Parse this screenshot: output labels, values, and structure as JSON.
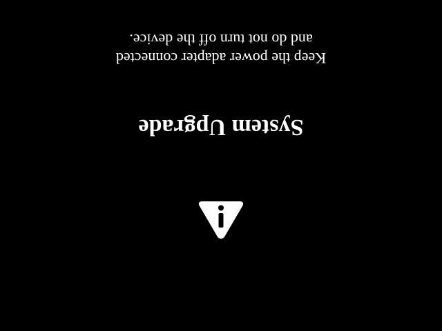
{
  "screen": {
    "orientation": "rotated-180",
    "background_color": "#000000",
    "text_color": "#ffffff"
  },
  "icon": {
    "name": "warning-triangle-exclamation-icon"
  },
  "title": "System Upgrade",
  "message": {
    "line1": "Keep the power adapter connected",
    "line2": "and do not turn off the device."
  }
}
